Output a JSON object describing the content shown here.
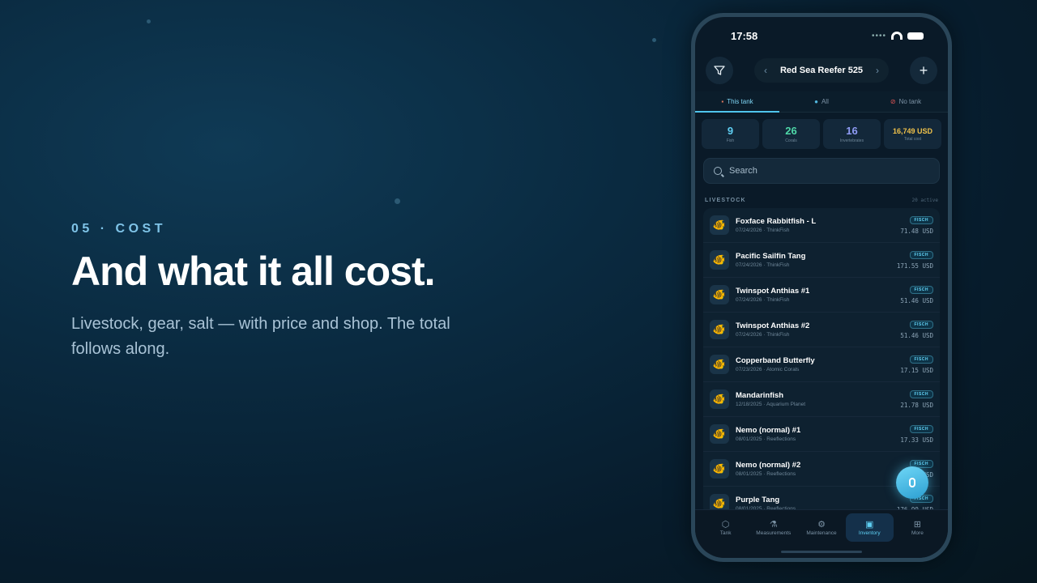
{
  "hero": {
    "eyebrow": "05 · COST",
    "headline": "And what it all cost.",
    "subtitle": "Livestock, gear, salt — with price and shop. The total follows along."
  },
  "status_bar": {
    "time": "17:58"
  },
  "top_bar": {
    "tank_name": "Red Sea Reefer 525",
    "prev": "‹",
    "next": "›",
    "add": "+"
  },
  "tabs": [
    {
      "label": "This tank",
      "icon": "fish-tank-icon",
      "active": true
    },
    {
      "label": "All",
      "icon": "globe-icon",
      "active": false
    },
    {
      "label": "No tank",
      "icon": "prohibited-icon",
      "active": false
    }
  ],
  "stats": [
    {
      "value": "9",
      "label": "Fish",
      "color": "#5fcff3"
    },
    {
      "value": "26",
      "label": "Corals",
      "color": "#4fd8a8"
    },
    {
      "value": "16",
      "label": "Invertebrates",
      "color": "#8f9cf5"
    },
    {
      "value": "16,749 USD",
      "label": "Total cost",
      "color": "#f1c24a"
    }
  ],
  "search": {
    "placeholder": "Search"
  },
  "livestock": {
    "title": "LIVESTOCK",
    "count": "20 active",
    "items": [
      {
        "name": "Foxface Rabbitfish - L",
        "meta": "07/24/2026 · ThinkFish",
        "badge": "FISCH",
        "price": "71.48 USD"
      },
      {
        "name": "Pacific Sailfin Tang",
        "meta": "07/24/2026 · ThinkFish",
        "badge": "FISCH",
        "price": "171.55 USD"
      },
      {
        "name": "Twinspot Anthias #1",
        "meta": "07/24/2026 · ThinkFish",
        "badge": "FISCH",
        "price": "51.46 USD"
      },
      {
        "name": "Twinspot Anthias #2",
        "meta": "07/24/2026 · ThinkFish",
        "badge": "FISCH",
        "price": "51.46 USD"
      },
      {
        "name": "Copperband Butterfly",
        "meta": "07/23/2026 · Atomic Corals",
        "badge": "FISCH",
        "price": "17.15 USD"
      },
      {
        "name": "Mandarinfish",
        "meta": "12/18/2025 · Aquarium Planet",
        "badge": "FISCH",
        "price": "21.78 USD"
      },
      {
        "name": "Nemo (normal) #1",
        "meta": "08/01/2025 · Reeflections",
        "badge": "FISCH",
        "price": "17.33 USD"
      },
      {
        "name": "Nemo (normal) #2",
        "meta": "08/01/2025 · Reeflections",
        "badge": "FISCH",
        "price": "17.33 USD"
      },
      {
        "name": "Purple Tang",
        "meta": "08/01/2025 · Reeflections",
        "badge": "FISCH",
        "price": "176.99 USD"
      }
    ]
  },
  "nav": [
    {
      "label": "Tank",
      "icon": "cube-icon",
      "glyph": "⬡",
      "active": false
    },
    {
      "label": "Measurements",
      "icon": "flask-icon",
      "glyph": "⚗",
      "active": false
    },
    {
      "label": "Maintenance",
      "icon": "wrench-icon",
      "glyph": "⚙",
      "active": false
    },
    {
      "label": "Inventory",
      "icon": "box-icon",
      "glyph": "▣",
      "active": true
    },
    {
      "label": "More",
      "icon": "grid-icon",
      "glyph": "⊞",
      "active": false
    }
  ]
}
